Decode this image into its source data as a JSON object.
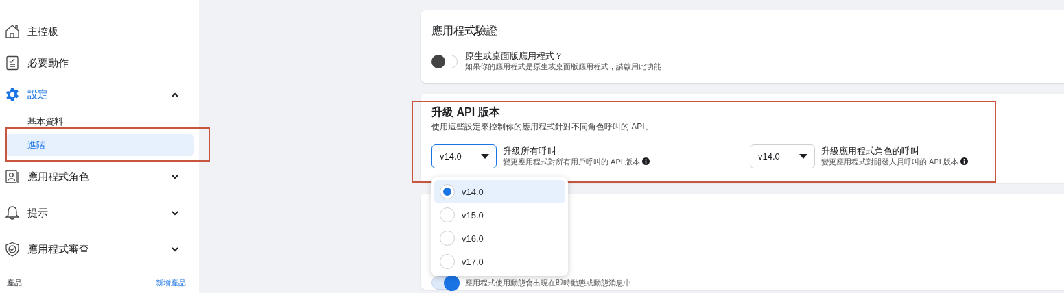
{
  "sidebar": {
    "items": [
      {
        "label": "主控板",
        "selected": false
      },
      {
        "label": "必要動作",
        "selected": false
      },
      {
        "label": "設定",
        "selected": true,
        "expanded": true,
        "children": [
          {
            "label": "基本資料",
            "selected": false,
            "highlighted": false
          },
          {
            "label": "進階",
            "selected": true,
            "highlighted": true
          }
        ]
      },
      {
        "label": "應用程式角色",
        "selected": false,
        "expanded": false
      },
      {
        "label": "提示",
        "selected": false,
        "expanded": false
      },
      {
        "label": "應用程式審查",
        "selected": false,
        "expanded": false
      }
    ],
    "footer": {
      "label": "產品",
      "link": "新增產品"
    }
  },
  "cards": [
    {
      "kind": "toggle",
      "title": "應用程式驗證",
      "highlighted": false,
      "toggle": {
        "on": false,
        "label": "原生或桌面版應用程式？",
        "description": "如果你的應用程式是原生或桌面版應用程式，請啟用此功能"
      }
    },
    {
      "kind": "versions",
      "title": "升級 API 版本",
      "description": "使用這些設定來控制你的應用程式針對不同角色呼叫的 API。",
      "highlighted": true,
      "selects": [
        {
          "value": "v14.0",
          "label": "升級所有呼叫",
          "description": "變更應用程式對所有用戶呼叫的 API 版本",
          "expanded": true,
          "options": [
            {
              "label": "v14.0",
              "selected": true
            },
            {
              "label": "v15.0",
              "selected": false
            },
            {
              "label": "v16.0",
              "selected": false
            },
            {
              "label": "v17.0",
              "selected": false
            }
          ]
        },
        {
          "value": "v14.0",
          "label": "升級應用程式角色的呼叫",
          "description": "變更應用程式對開發人員呼叫的 API 版本",
          "expanded": false
        }
      ]
    },
    {
      "kind": "toggle",
      "highlighted": false,
      "toggle": {
        "on": true,
        "description": "應用程式使用動態會出現在即時動態或動態消息中"
      }
    }
  ]
}
